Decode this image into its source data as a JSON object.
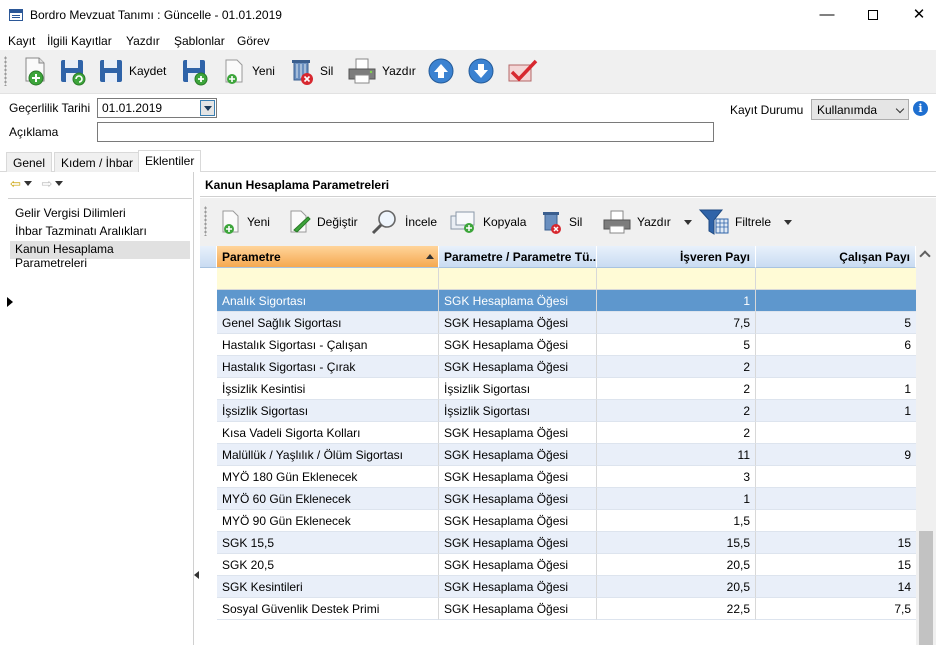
{
  "window": {
    "title": "Bordro Mevzuat Tanımı : Güncelle - 01.01.2019",
    "minimize_glyph": "—",
    "close_glyph": "✕"
  },
  "menu": [
    "Kayıt",
    "İlgili Kayıtlar",
    "Yazdır",
    "Şablonlar",
    "Görev"
  ],
  "toolbar": {
    "save_label": "Kaydet",
    "new_label": "Yeni",
    "delete_label": "Sil",
    "print_label": "Yazdır",
    "icons": [
      "new-record-icon",
      "save-refresh-icon",
      "save-icon",
      "save-new-icon",
      "new-document-icon",
      "delete-icon",
      "printer-icon",
      "arrow-up-icon",
      "arrow-down-icon",
      "approve-icon"
    ]
  },
  "form": {
    "validity_label": "Geçerlilik Tarihi",
    "validity_value": "01.01.2019",
    "description_label": "Açıklama",
    "description_value": "",
    "status_label": "Kayıt Durumu",
    "status_value": "Kullanımda",
    "info_glyph": "i"
  },
  "tabs": [
    "Genel",
    "Kıdem / İhbar",
    "Eklentiler"
  ],
  "active_tab": "Eklentiler",
  "nav": {
    "back_glyph": "⇦",
    "forward_glyph": "⇨"
  },
  "sidebar": {
    "items": [
      {
        "label": "Gelir Vergisi Dilimleri"
      },
      {
        "label": "İhbar Tazminatı Aralıkları"
      },
      {
        "label": "Kanun Hesaplama Parametreleri"
      }
    ],
    "selected": "Kanun Hesaplama Parametreleri"
  },
  "panel": {
    "title": "Kanun Hesaplama Parametreleri",
    "toolbar": {
      "new": "Yeni",
      "edit": "Değiştir",
      "inspect": "İncele",
      "copy": "Kopyala",
      "delete": "Sil",
      "print": "Yazdır",
      "filter": "Filtrele"
    }
  },
  "grid": {
    "columns": [
      "Parametre",
      "Parametre / Parametre Tü...",
      "İşveren Payı",
      "Çalışan Payı"
    ],
    "sorted_column": "Parametre",
    "selected_row": 0,
    "rows": [
      {
        "param": "Analık Sigortası",
        "type": "SGK Hesaplama Öğesi",
        "employer": "1",
        "employee": ""
      },
      {
        "param": "Genel Sağlık Sigortası",
        "type": "SGK Hesaplama Öğesi",
        "employer": "7,5",
        "employee": "5"
      },
      {
        "param": "Hastalık Sigortası - Çalışan",
        "type": "SGK Hesaplama Öğesi",
        "employer": "5",
        "employee": "6"
      },
      {
        "param": "Hastalık Sigortası - Çırak",
        "type": "SGK Hesaplama Öğesi",
        "employer": "2",
        "employee": ""
      },
      {
        "param": "İşsizlik Kesintisi",
        "type": "İşsizlik Sigortası",
        "employer": "2",
        "employee": "1"
      },
      {
        "param": "İşsizlik Sigortası",
        "type": "İşsizlik Sigortası",
        "employer": "2",
        "employee": "1"
      },
      {
        "param": "Kısa Vadeli Sigorta Kolları",
        "type": "SGK Hesaplama Öğesi",
        "employer": "2",
        "employee": ""
      },
      {
        "param": "Malüllük / Yaşlılık / Ölüm Sigortası",
        "type": "SGK Hesaplama Öğesi",
        "employer": "11",
        "employee": "9"
      },
      {
        "param": "MYÖ 180 Gün Eklenecek",
        "type": "SGK Hesaplama Öğesi",
        "employer": "3",
        "employee": ""
      },
      {
        "param": "MYÖ 60 Gün Eklenecek",
        "type": "SGK Hesaplama Öğesi",
        "employer": "1",
        "employee": ""
      },
      {
        "param": "MYÖ 90 Gün Eklenecek",
        "type": "SGK Hesaplama Öğesi",
        "employer": "1,5",
        "employee": ""
      },
      {
        "param": "SGK 15,5",
        "type": "SGK Hesaplama Öğesi",
        "employer": "15,5",
        "employee": "15"
      },
      {
        "param": "SGK 20,5",
        "type": "SGK Hesaplama Öğesi",
        "employer": "20,5",
        "employee": "15"
      },
      {
        "param": "SGK Kesintileri",
        "type": "SGK Hesaplama Öğesi",
        "employer": "20,5",
        "employee": "14"
      },
      {
        "param": "Sosyal Güvenlik Destek Primi",
        "type": "SGK Hesaplama Öğesi",
        "employer": "22,5",
        "employee": "7,5"
      }
    ]
  },
  "colors": {
    "selected_row": "#5e97cd",
    "alt_row": "#e9eff9",
    "sorted_header": "#f5a951",
    "header": "#c9dcf2",
    "filter_row": "#fffbd6",
    "toolbar_bg": "#f0f0f0"
  }
}
